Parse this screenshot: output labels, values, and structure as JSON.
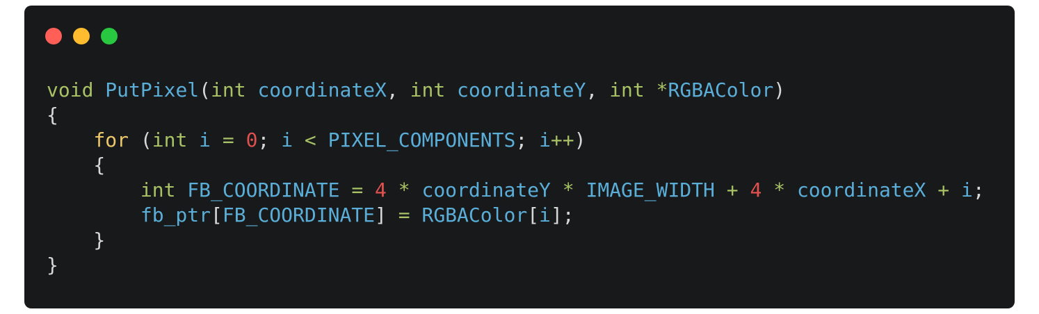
{
  "window": {
    "controls": {
      "close_color": "#ff5f57",
      "minimize_color": "#febc2e",
      "maximize_color": "#28c840"
    },
    "background": "#18191b"
  },
  "colors": {
    "keyword": "#a8c265",
    "control": "#ecc86a",
    "identifier": "#5aaed8",
    "number": "#e0504f",
    "punctuation": "#d8d8d8"
  },
  "code": {
    "lines": [
      [
        {
          "t": "kw",
          "v": "void"
        },
        {
          "t": "pun",
          "v": " "
        },
        {
          "t": "fn",
          "v": "PutPixel"
        },
        {
          "t": "pun",
          "v": "("
        },
        {
          "t": "kw",
          "v": "int"
        },
        {
          "t": "pun",
          "v": " "
        },
        {
          "t": "fn",
          "v": "coordinateX"
        },
        {
          "t": "pun",
          "v": ", "
        },
        {
          "t": "kw",
          "v": "int"
        },
        {
          "t": "pun",
          "v": " "
        },
        {
          "t": "fn",
          "v": "coordinateY"
        },
        {
          "t": "pun",
          "v": ", "
        },
        {
          "t": "kw",
          "v": "int"
        },
        {
          "t": "pun",
          "v": " "
        },
        {
          "t": "op",
          "v": "*"
        },
        {
          "t": "fn",
          "v": "RGBAColor"
        },
        {
          "t": "pun",
          "v": ")"
        }
      ],
      [
        {
          "t": "pun",
          "v": "{"
        }
      ],
      [
        {
          "t": "pun",
          "v": "    "
        },
        {
          "t": "ctl",
          "v": "for"
        },
        {
          "t": "pun",
          "v": " ("
        },
        {
          "t": "kw",
          "v": "int"
        },
        {
          "t": "pun",
          "v": " "
        },
        {
          "t": "fn",
          "v": "i"
        },
        {
          "t": "pun",
          "v": " "
        },
        {
          "t": "op",
          "v": "="
        },
        {
          "t": "pun",
          "v": " "
        },
        {
          "t": "num",
          "v": "0"
        },
        {
          "t": "pun",
          "v": "; "
        },
        {
          "t": "fn",
          "v": "i"
        },
        {
          "t": "pun",
          "v": " "
        },
        {
          "t": "op",
          "v": "<"
        },
        {
          "t": "pun",
          "v": " "
        },
        {
          "t": "fn",
          "v": "PIXEL_COMPONENTS"
        },
        {
          "t": "pun",
          "v": "; "
        },
        {
          "t": "fn",
          "v": "i"
        },
        {
          "t": "op",
          "v": "++"
        },
        {
          "t": "pun",
          "v": ")"
        }
      ],
      [
        {
          "t": "pun",
          "v": "    {"
        }
      ],
      [
        {
          "t": "pun",
          "v": "        "
        },
        {
          "t": "kw",
          "v": "int"
        },
        {
          "t": "pun",
          "v": " "
        },
        {
          "t": "fn",
          "v": "FB_COORDINATE"
        },
        {
          "t": "pun",
          "v": " "
        },
        {
          "t": "op",
          "v": "="
        },
        {
          "t": "pun",
          "v": " "
        },
        {
          "t": "num",
          "v": "4"
        },
        {
          "t": "pun",
          "v": " "
        },
        {
          "t": "op",
          "v": "*"
        },
        {
          "t": "pun",
          "v": " "
        },
        {
          "t": "fn",
          "v": "coordinateY"
        },
        {
          "t": "pun",
          "v": " "
        },
        {
          "t": "op",
          "v": "*"
        },
        {
          "t": "pun",
          "v": " "
        },
        {
          "t": "fn",
          "v": "IMAGE_WIDTH"
        },
        {
          "t": "pun",
          "v": " "
        },
        {
          "t": "op",
          "v": "+"
        },
        {
          "t": "pun",
          "v": " "
        },
        {
          "t": "num",
          "v": "4"
        },
        {
          "t": "pun",
          "v": " "
        },
        {
          "t": "op",
          "v": "*"
        },
        {
          "t": "pun",
          "v": " "
        },
        {
          "t": "fn",
          "v": "coordinateX"
        },
        {
          "t": "pun",
          "v": " "
        },
        {
          "t": "op",
          "v": "+"
        },
        {
          "t": "pun",
          "v": " "
        },
        {
          "t": "fn",
          "v": "i"
        },
        {
          "t": "pun",
          "v": ";"
        }
      ],
      [
        {
          "t": "pun",
          "v": "        "
        },
        {
          "t": "fn",
          "v": "fb_ptr"
        },
        {
          "t": "pun",
          "v": "["
        },
        {
          "t": "fn",
          "v": "FB_COORDINATE"
        },
        {
          "t": "pun",
          "v": "] "
        },
        {
          "t": "op",
          "v": "="
        },
        {
          "t": "pun",
          "v": " "
        },
        {
          "t": "fn",
          "v": "RGBAColor"
        },
        {
          "t": "pun",
          "v": "["
        },
        {
          "t": "fn",
          "v": "i"
        },
        {
          "t": "pun",
          "v": "];"
        }
      ],
      [
        {
          "t": "pun",
          "v": "    }"
        }
      ],
      [
        {
          "t": "pun",
          "v": "}"
        }
      ]
    ]
  }
}
